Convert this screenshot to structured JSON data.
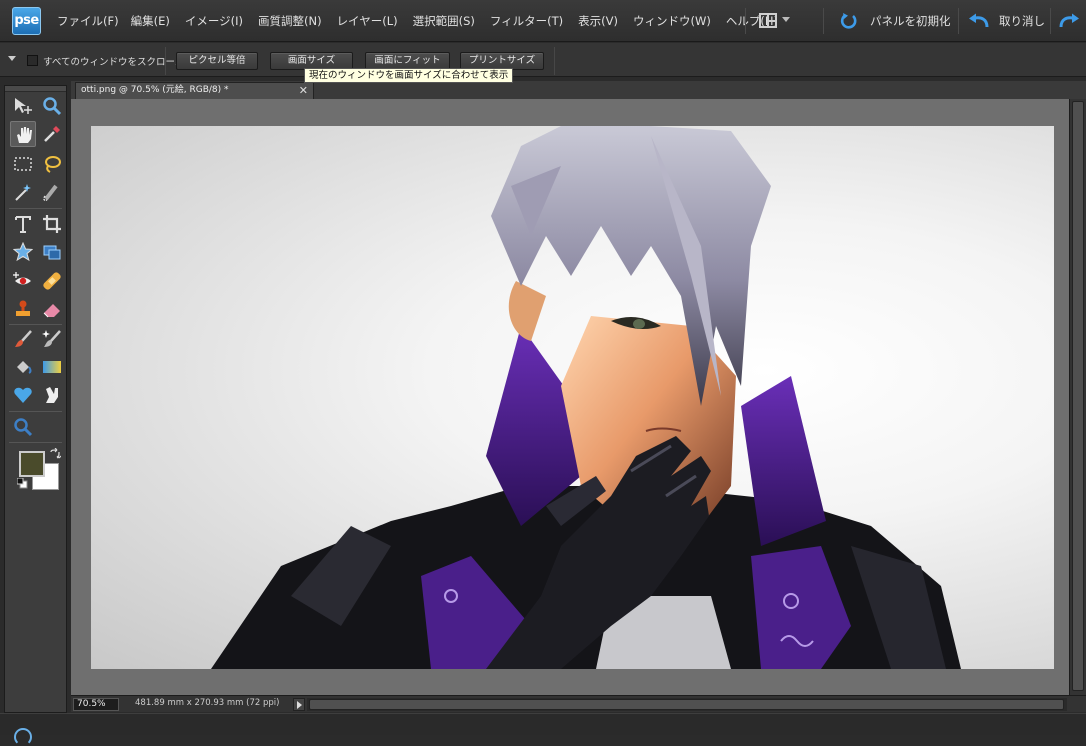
{
  "app": {
    "logo_text": "pse",
    "accent": "#2f8fd8"
  },
  "menu": {
    "items": [
      "ファイル(F)",
      "編集(E)",
      "イメージ(I)",
      "画質調整(N)",
      "レイヤー(L)",
      "選択範囲(S)",
      "フィルター(T)",
      "表示(V)",
      "ウィンドウ(W)",
      "ヘルプ(H)"
    ],
    "reset_panels": "パネルを初期化",
    "undo": "取り消し"
  },
  "options": {
    "scroll_all_label": "すべてのウィンドウをスクロール",
    "scroll_all_checked": false,
    "buttons": [
      "ピクセル等倍",
      "画面サイズ",
      "画面にフィット",
      "プリントサイズ"
    ],
    "tooltip": "現在のウィンドウを画面サイズに合わせて表示"
  },
  "toolbox": {
    "active_tool": "hand-tool",
    "foreground_color": "#4a4b2b",
    "background_color": "#ffffff"
  },
  "document": {
    "tab_title": "otti.png @ 70.5% (元絵, RGB/8) *",
    "zoom": "70.5%",
    "info": "481.89 mm x 270.93 mm (72 ppi)"
  }
}
